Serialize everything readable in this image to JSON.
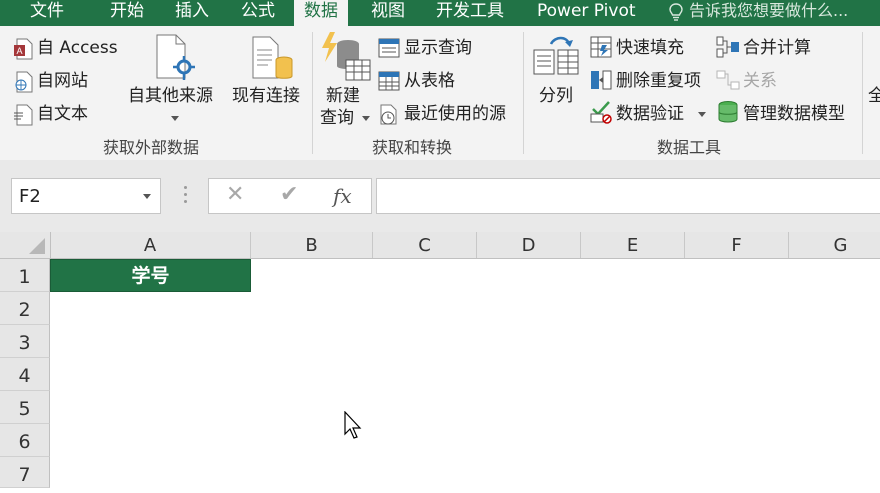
{
  "tabs": [
    {
      "label": "文件",
      "active": false
    },
    {
      "label": "开始",
      "active": false
    },
    {
      "label": "插入",
      "active": false
    },
    {
      "label": "公式",
      "active": false
    },
    {
      "label": "数据",
      "active": true
    },
    {
      "label": "视图",
      "active": false
    },
    {
      "label": "开发工具",
      "active": false
    },
    {
      "label": "Power Pivot",
      "active": false
    }
  ],
  "tell_me": "告诉我您想要做什么...",
  "ribbon": {
    "get_external": {
      "group_label": "获取外部数据",
      "from_access": "自 Access",
      "from_web": "自网站",
      "from_text": "自文本",
      "from_other": "自其他来源",
      "existing": "现有连接"
    },
    "get_transform": {
      "group_label": "获取和转换",
      "new_query_line1": "新建",
      "new_query_line2": "查询",
      "show_queries": "显示查询",
      "from_table": "从表格",
      "recent_sources": "最近使用的源"
    },
    "data_tools": {
      "group_label": "数据工具",
      "text_to_columns": "分列",
      "flash_fill": "快速填充",
      "remove_duplicates": "删除重复项",
      "data_validation": "数据验证",
      "consolidate": "合并计算",
      "relationships": "关系",
      "manage_model": "管理数据模型"
    },
    "partial_right": "全"
  },
  "formula_bar": {
    "name_box": "F2",
    "cancel": "✕",
    "enter": "✔",
    "fx": "fx",
    "value": ""
  },
  "columns": [
    "A",
    "B",
    "C",
    "D",
    "E",
    "F",
    "G"
  ],
  "rows": [
    "1",
    "2",
    "3",
    "4",
    "5",
    "6",
    "7"
  ],
  "cells": {
    "A1": "学号"
  },
  "colors": {
    "accent": "#217346"
  }
}
